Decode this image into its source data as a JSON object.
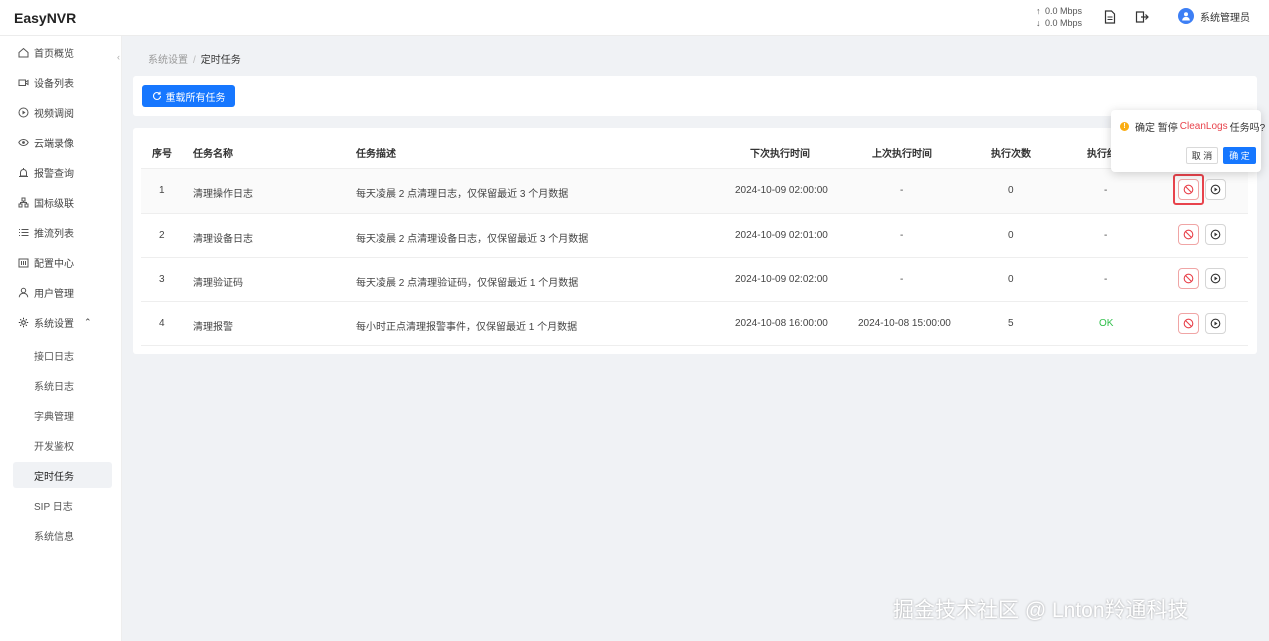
{
  "app": {
    "title": "EasyNVR"
  },
  "header": {
    "upload_speed": "0.0 Mbps",
    "download_speed": "0.0 Mbps",
    "user_name": "系统管理员"
  },
  "sidebar": {
    "items": [
      {
        "label": "首页概览",
        "icon": "home-icon"
      },
      {
        "label": "设备列表",
        "icon": "camera-icon"
      },
      {
        "label": "视频调阅",
        "icon": "play-circle-icon"
      },
      {
        "label": "云端录像",
        "icon": "eye-icon"
      },
      {
        "label": "报警查询",
        "icon": "alarm-icon"
      },
      {
        "label": "国标级联",
        "icon": "cascade-icon"
      },
      {
        "label": "推流列表",
        "icon": "list-icon"
      },
      {
        "label": "配置中心",
        "icon": "config-icon"
      },
      {
        "label": "用户管理",
        "icon": "user-icon"
      },
      {
        "label": "系统设置",
        "icon": "gear-icon"
      }
    ],
    "sub_items": [
      {
        "label": "接口日志"
      },
      {
        "label": "系统日志"
      },
      {
        "label": "字典管理"
      },
      {
        "label": "开发鉴权"
      },
      {
        "label": "定时任务"
      },
      {
        "label": "SIP 日志"
      },
      {
        "label": "系统信息"
      }
    ]
  },
  "breadcrumb": {
    "parent": "系统设置",
    "separator": "/",
    "current": "定时任务"
  },
  "toolbar": {
    "reload_label": "重载所有任务"
  },
  "table": {
    "headers": [
      "序号",
      "任务名称",
      "任务描述",
      "下次执行时间",
      "上次执行时间",
      "执行次数",
      "执行结"
    ],
    "rows": [
      {
        "no": "1",
        "name": "清理操作日志",
        "desc": "每天凌晨 2 点清理日志，仅保留最近 3 个月数据",
        "next": "2024-10-09 02:00:00",
        "last": "-",
        "count": "0",
        "result": "-"
      },
      {
        "no": "2",
        "name": "清理设备日志",
        "desc": "每天凌晨 2 点清理设备日志，仅保留最近 3 个月数据",
        "next": "2024-10-09 02:01:00",
        "last": "-",
        "count": "0",
        "result": "-"
      },
      {
        "no": "3",
        "name": "清理验证码",
        "desc": "每天凌晨 2 点清理验证码，仅保留最近 1 个月数据",
        "next": "2024-10-09 02:02:00",
        "last": "-",
        "count": "0",
        "result": "-"
      },
      {
        "no": "4",
        "name": "清理报警",
        "desc": "每小时正点清理报警事件，仅保留最近 1 个月数据",
        "next": "2024-10-08 16:00:00",
        "last": "2024-10-08 15:00:00",
        "count": "5",
        "result": "OK"
      }
    ]
  },
  "popconfirm": {
    "prefix": "确定 暂停",
    "task": "CleanLogs",
    "suffix": "任务吗?",
    "cancel_label": "取 消",
    "ok_label": "确 定"
  },
  "watermark": "掘金技术社区 @ Lnton羚通科技",
  "colors": {
    "primary": "#1677ff",
    "danger": "#e8434c",
    "success": "#2fbf4a",
    "warning": "#faad14"
  }
}
